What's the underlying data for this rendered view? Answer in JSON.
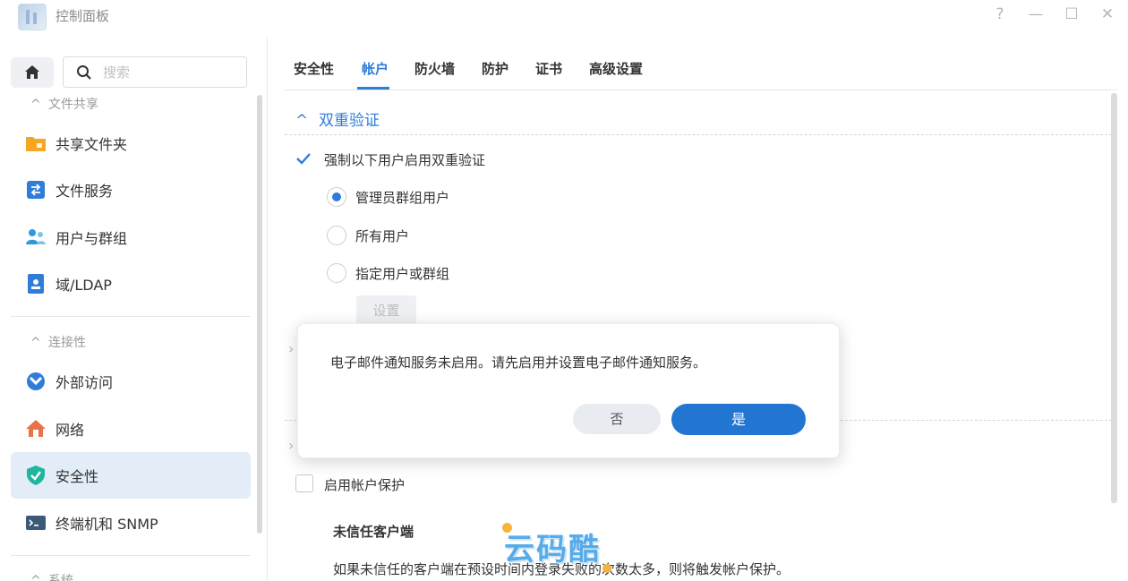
{
  "window": {
    "title": "控制面板",
    "controls": [
      "?",
      "—",
      "☐",
      "✕"
    ]
  },
  "sidebar": {
    "search_placeholder": "搜索",
    "sections": [
      {
        "label": "文件共享"
      },
      {
        "label": "连接性"
      },
      {
        "label": "系统"
      }
    ],
    "items": [
      {
        "label": "共享文件夹",
        "icon": "folder-icon"
      },
      {
        "label": "文件服务",
        "icon": "file-services-icon"
      },
      {
        "label": "用户与群组",
        "icon": "users-icon"
      },
      {
        "label": "域/LDAP",
        "icon": "domain-icon"
      },
      {
        "label": "外部访问",
        "icon": "external-access-icon"
      },
      {
        "label": "网络",
        "icon": "network-icon"
      },
      {
        "label": "安全性",
        "icon": "shield-icon",
        "active": true
      },
      {
        "label": "终端机和 SNMP",
        "icon": "terminal-icon"
      }
    ]
  },
  "tabs": [
    {
      "label": "安全性"
    },
    {
      "label": "帐户",
      "active": true
    },
    {
      "label": "防火墙"
    },
    {
      "label": "防护"
    },
    {
      "label": "证书"
    },
    {
      "label": "高级设置"
    }
  ],
  "main": {
    "two_factor": {
      "title": "双重验证",
      "enforce_label": "强制以下用户启用双重验证",
      "enforce_checked": true,
      "options": [
        {
          "label": "管理员群组用户",
          "checked": true
        },
        {
          "label": "所有用户",
          "checked": false
        },
        {
          "label": "指定用户或群组",
          "checked": false
        }
      ],
      "settings_button": "设置"
    },
    "account_protection": {
      "enable_label": "启用帐户保护",
      "enable_checked": false,
      "untrusted_title": "未信任客户端",
      "untrusted_desc": "如果未信任的客户端在预设时间内登录失败的次数太多，则将触发帐户保护。"
    }
  },
  "dialog": {
    "message": "电子邮件通知服务未启用。请先启用并设置电子邮件通知服务。",
    "no_label": "否",
    "yes_label": "是"
  },
  "watermark": {
    "text": "云码酷"
  },
  "colors": {
    "accent": "#2f7dd8",
    "primary_button": "#2276d2",
    "active_nav": "#e3edf8"
  }
}
